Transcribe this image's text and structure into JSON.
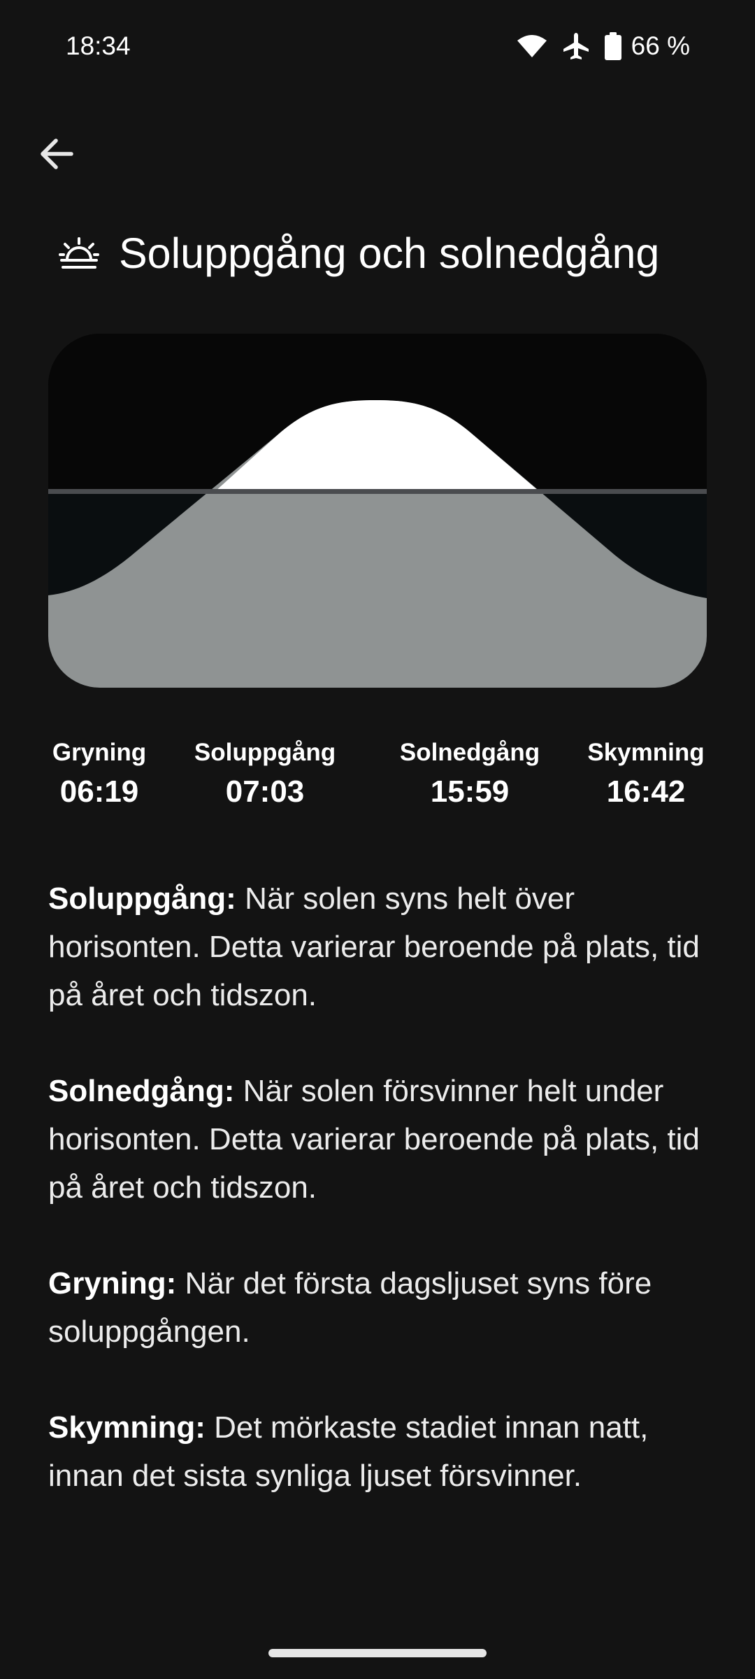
{
  "status_bar": {
    "time": "18:34",
    "battery": "66 %",
    "icons": [
      "wifi-icon",
      "airplane-icon",
      "battery-icon"
    ]
  },
  "header": {
    "back_icon": "arrow-back-icon",
    "title_icon": "sunrise-icon",
    "title": "Soluppgång och solnedgång"
  },
  "chart": {
    "type": "area",
    "description_colors": {
      "night": "#070707",
      "below_horizon": "#0a0e10",
      "daylight": "#ffffff",
      "ground": "#8f9393",
      "horizon": "#4a4c4f"
    }
  },
  "times": {
    "dawn": {
      "label": "Gryning",
      "value": "06:19"
    },
    "sunrise": {
      "label": "Soluppgång",
      "value": "07:03"
    },
    "sunset": {
      "label": "Solnedgång",
      "value": "15:59"
    },
    "dusk": {
      "label": "Skymning",
      "value": "16:42"
    }
  },
  "descriptions": [
    {
      "term": "Soluppgång:",
      "text": " När solen syns helt över horisonten. Detta varierar beroende på plats, tid på året och tidszon."
    },
    {
      "term": "Solnedgång:",
      "text": " När solen försvinner helt under horisonten. Detta varierar beroende på plats, tid på året och tidszon."
    },
    {
      "term": "Gryning:",
      "text": " När det första dagsljuset syns före soluppgången."
    },
    {
      "term": "Skymning:",
      "text": " Det mörkaste stadiet innan natt, innan det sista synliga ljuset försvinner."
    }
  ]
}
